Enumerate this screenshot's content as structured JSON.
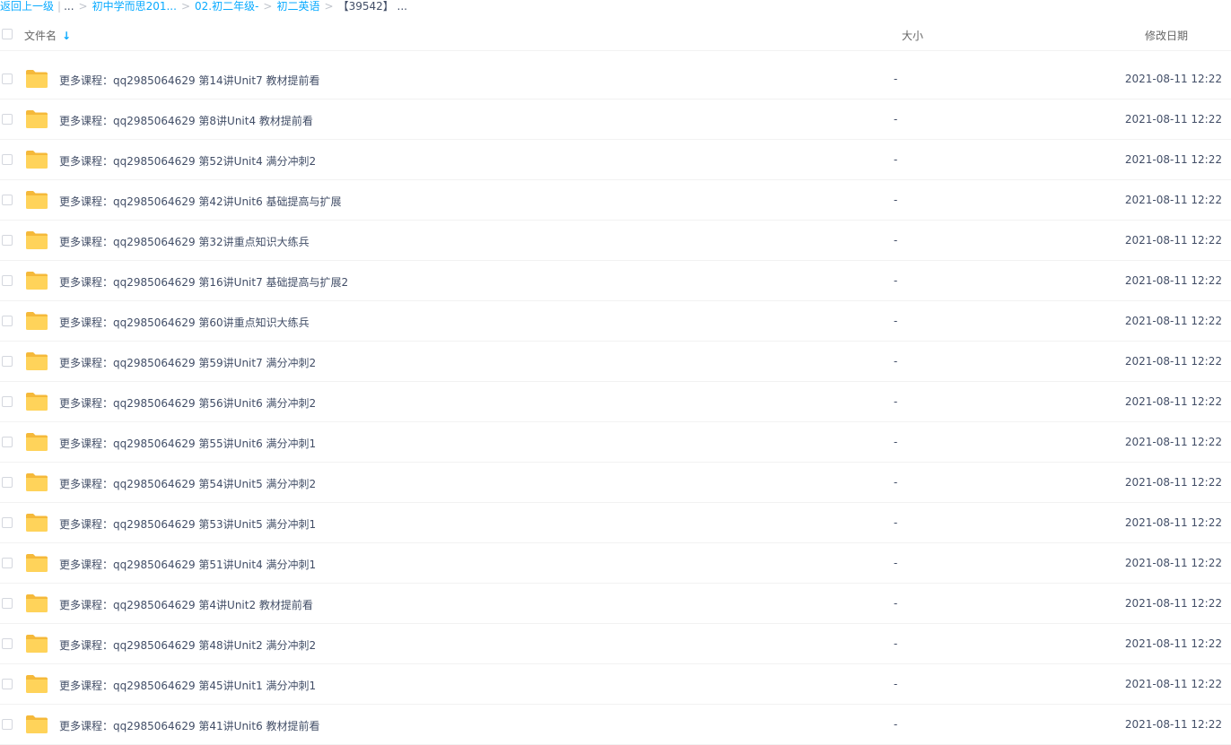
{
  "breadcrumb": {
    "back": "返回上一级",
    "ellipsis": "...",
    "items": [
      "初中学而思201...",
      "02.初二年级-",
      "初二英语"
    ],
    "current": "【39542】 ..."
  },
  "header": {
    "name": "文件名",
    "size": "大小",
    "date": "修改日期"
  },
  "colors": {
    "accent": "#09aaff",
    "folder": "#ffd35a"
  },
  "files": [
    {
      "name": "更多课程：qq2985064629 第14讲Unit7 教材提前看",
      "size": "-",
      "date": "2021-08-11 12:22"
    },
    {
      "name": "更多课程：qq2985064629 第8讲Unit4 教材提前看",
      "size": "-",
      "date": "2021-08-11 12:22"
    },
    {
      "name": "更多课程：qq2985064629 第52讲Unit4 满分冲刺2",
      "size": "-",
      "date": "2021-08-11 12:22"
    },
    {
      "name": "更多课程：qq2985064629 第42讲Unit6 基础提高与扩展",
      "size": "-",
      "date": "2021-08-11 12:22"
    },
    {
      "name": "更多课程：qq2985064629 第32讲重点知识大练兵",
      "size": "-",
      "date": "2021-08-11 12:22"
    },
    {
      "name": "更多课程：qq2985064629 第16讲Unit7 基础提高与扩展2",
      "size": "-",
      "date": "2021-08-11 12:22"
    },
    {
      "name": "更多课程：qq2985064629 第60讲重点知识大练兵",
      "size": "-",
      "date": "2021-08-11 12:22"
    },
    {
      "name": "更多课程：qq2985064629 第59讲Unit7 满分冲刺2",
      "size": "-",
      "date": "2021-08-11 12:22"
    },
    {
      "name": "更多课程：qq2985064629 第56讲Unit6 满分冲刺2",
      "size": "-",
      "date": "2021-08-11 12:22"
    },
    {
      "name": "更多课程：qq2985064629 第55讲Unit6 满分冲刺1",
      "size": "-",
      "date": "2021-08-11 12:22"
    },
    {
      "name": "更多课程：qq2985064629 第54讲Unit5 满分冲刺2",
      "size": "-",
      "date": "2021-08-11 12:22"
    },
    {
      "name": "更多课程：qq2985064629 第53讲Unit5 满分冲刺1",
      "size": "-",
      "date": "2021-08-11 12:22"
    },
    {
      "name": "更多课程：qq2985064629 第51讲Unit4 满分冲刺1",
      "size": "-",
      "date": "2021-08-11 12:22"
    },
    {
      "name": "更多课程：qq2985064629 第4讲Unit2 教材提前看",
      "size": "-",
      "date": "2021-08-11 12:22"
    },
    {
      "name": "更多课程：qq2985064629 第48讲Unit2 满分冲刺2",
      "size": "-",
      "date": "2021-08-11 12:22"
    },
    {
      "name": "更多课程：qq2985064629 第45讲Unit1 满分冲刺1",
      "size": "-",
      "date": "2021-08-11 12:22"
    },
    {
      "name": "更多课程：qq2985064629 第41讲Unit6 教材提前看",
      "size": "-",
      "date": "2021-08-11 12:22"
    }
  ]
}
